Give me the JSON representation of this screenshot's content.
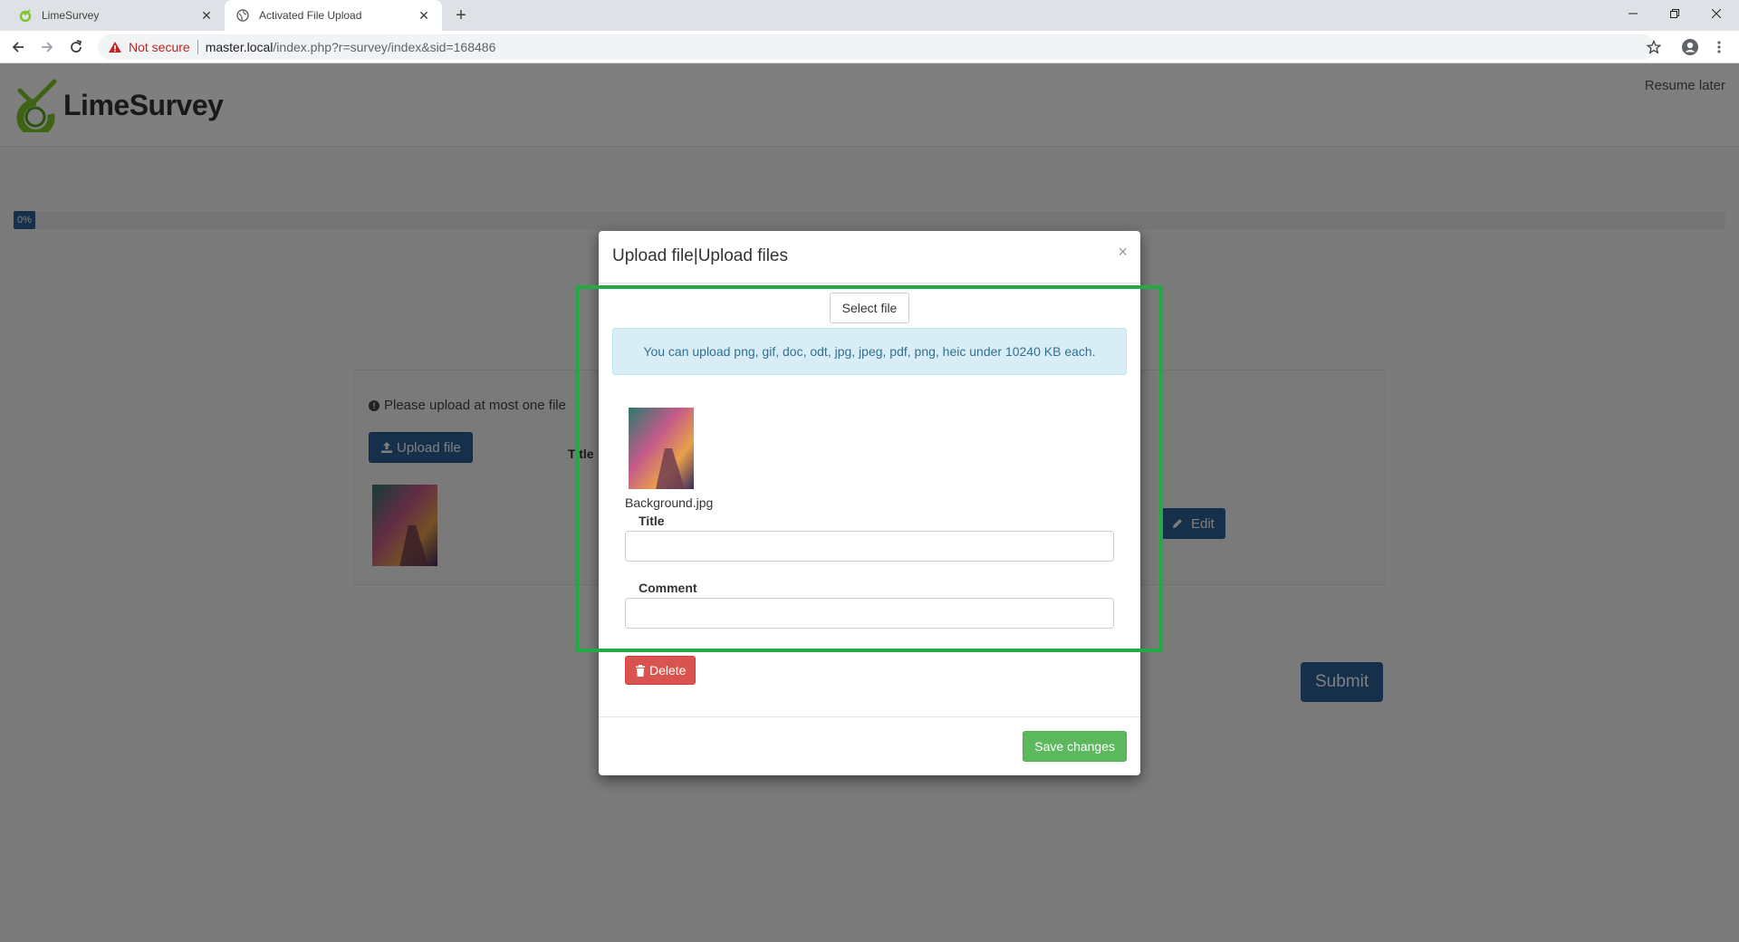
{
  "browser": {
    "tabs": [
      {
        "title": "LimeSurvey",
        "active": false
      },
      {
        "title": "Activated File Upload",
        "active": true
      }
    ],
    "security_label": "Not secure",
    "url_host": "master.local",
    "url_path": "/index.php?r=survey/index&sid=168486"
  },
  "header": {
    "logo_text": "LimeSurvey",
    "resume_later": "Resume later"
  },
  "progress": {
    "label": "0%",
    "value": 0
  },
  "question": {
    "tip": "Please upload at most one file",
    "upload_button": "Upload file",
    "title_column": "Title",
    "edit_button": "Edit"
  },
  "submit_button": "Submit",
  "modal": {
    "title": "Upload file|Upload files",
    "close_symbol": "×",
    "select_file_button": "Select file",
    "allowed_info": "You can upload png, gif, doc, odt, jpg, jpeg, pdf, png, heic under 10240 KB each.",
    "file": {
      "name": "Background.jpg",
      "title_label": "Title",
      "title_value": "",
      "comment_label": "Comment",
      "comment_value": ""
    },
    "delete_button": "Delete",
    "save_button": "Save changes"
  },
  "colors": {
    "primary": "#2d5f94",
    "danger": "#d9534f",
    "success": "#5cb85c",
    "highlight": "#22aa44",
    "logo_green": "#7ec62b"
  }
}
